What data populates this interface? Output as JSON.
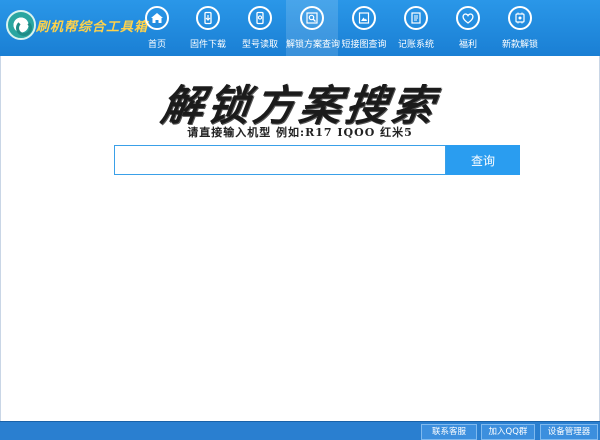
{
  "app": {
    "title": "刷机帮综合工具箱"
  },
  "nav": {
    "items": [
      {
        "label": "首页",
        "icon": "home-icon"
      },
      {
        "label": "固件下载",
        "icon": "firmware-download-icon"
      },
      {
        "label": "型号读取",
        "icon": "phone-read-icon"
      },
      {
        "label": "解锁方案查询",
        "icon": "unlock-search-icon"
      },
      {
        "label": "短接图查询",
        "icon": "image-search-icon"
      },
      {
        "label": "记账系统",
        "icon": "ledger-icon"
      },
      {
        "label": "福利",
        "icon": "heart-icon"
      },
      {
        "label": "新款解锁",
        "icon": "new-unlock-icon"
      }
    ],
    "active_index": 3
  },
  "main": {
    "heading": "解锁方案搜索",
    "hint": "请直接输入机型 例如:R17 IQOO 红米5",
    "search": {
      "value": "",
      "placeholder": "",
      "button_label": "查询"
    }
  },
  "statusbar": {
    "contact_label": "联系客服",
    "join_qq_label": "加入QQ群",
    "device_manager_label": "设备管理器"
  },
  "colors": {
    "topbar": "#1f88dc",
    "accent": "#2a9df0",
    "logo_text": "#ffd24a"
  }
}
